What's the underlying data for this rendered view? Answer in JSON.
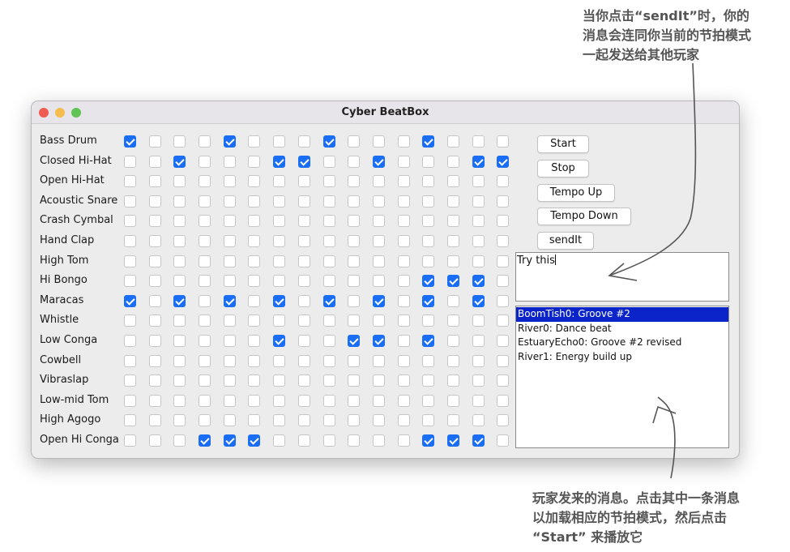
{
  "annotations": {
    "top": "当你点击“sendIt”时，你的\n消息会连同你当前的节拍模式\n一起发送给其他玩家",
    "bottom": "玩家发来的消息。点击其中一条消息\n以加载相应的节拍模式，然后点击\n“Start” 来播放它"
  },
  "window": {
    "title": "Cyber BeatBox"
  },
  "instruments": [
    "Bass Drum",
    "Closed Hi-Hat",
    "Open Hi-Hat",
    "Acoustic Snare",
    "Crash Cymbal",
    "Hand Clap",
    "High Tom",
    "Hi Bongo",
    "Maracas",
    "Whistle",
    "Low Conga",
    "Cowbell",
    "Vibraslap",
    "Low-mid Tom",
    "High Agogo",
    "Open Hi Conga"
  ],
  "grid": [
    [
      1,
      0,
      0,
      0,
      1,
      0,
      0,
      0,
      1,
      0,
      0,
      0,
      1,
      0,
      0,
      0
    ],
    [
      0,
      0,
      1,
      0,
      0,
      0,
      1,
      1,
      0,
      0,
      1,
      0,
      0,
      0,
      1,
      1
    ],
    [
      0,
      0,
      0,
      0,
      0,
      0,
      0,
      0,
      0,
      0,
      0,
      0,
      0,
      0,
      0,
      0
    ],
    [
      0,
      0,
      0,
      0,
      0,
      0,
      0,
      0,
      0,
      0,
      0,
      0,
      0,
      0,
      0,
      0
    ],
    [
      0,
      0,
      0,
      0,
      0,
      0,
      0,
      0,
      0,
      0,
      0,
      0,
      0,
      0,
      0,
      0
    ],
    [
      0,
      0,
      0,
      0,
      0,
      0,
      0,
      0,
      0,
      0,
      0,
      0,
      0,
      0,
      0,
      0
    ],
    [
      0,
      0,
      0,
      0,
      0,
      0,
      0,
      0,
      0,
      0,
      0,
      0,
      0,
      0,
      0,
      0
    ],
    [
      0,
      0,
      0,
      0,
      0,
      0,
      0,
      0,
      0,
      0,
      0,
      0,
      1,
      1,
      1,
      0
    ],
    [
      1,
      0,
      1,
      0,
      1,
      0,
      1,
      0,
      1,
      0,
      1,
      0,
      1,
      0,
      1,
      0
    ],
    [
      0,
      0,
      0,
      0,
      0,
      0,
      0,
      0,
      0,
      0,
      0,
      0,
      0,
      0,
      0,
      0
    ],
    [
      0,
      0,
      0,
      0,
      0,
      0,
      1,
      0,
      0,
      1,
      1,
      0,
      1,
      0,
      0,
      0
    ],
    [
      0,
      0,
      0,
      0,
      0,
      0,
      0,
      0,
      0,
      0,
      0,
      0,
      0,
      0,
      0,
      0
    ],
    [
      0,
      0,
      0,
      0,
      0,
      0,
      0,
      0,
      0,
      0,
      0,
      0,
      0,
      0,
      0,
      0
    ],
    [
      0,
      0,
      0,
      0,
      0,
      0,
      0,
      0,
      0,
      0,
      0,
      0,
      0,
      0,
      0,
      0
    ],
    [
      0,
      0,
      0,
      0,
      0,
      0,
      0,
      0,
      0,
      0,
      0,
      0,
      0,
      0,
      0,
      0
    ],
    [
      0,
      0,
      0,
      1,
      1,
      1,
      0,
      0,
      0,
      0,
      0,
      0,
      1,
      1,
      1,
      0
    ]
  ],
  "buttons": {
    "start": "Start",
    "stop": "Stop",
    "tempo_up": "Tempo Up",
    "tempo_down": "Tempo Down",
    "send": "sendIt"
  },
  "message_input": {
    "value": "Try this"
  },
  "incoming_messages": [
    "BoomTish0: Groove #2",
    "River0: Dance beat",
    "EstuaryEcho0: Groove #2 revised",
    "River1: Energy build up"
  ],
  "selected_message_index": 0,
  "colors": {
    "checkbox_checked": "#1a6ef5",
    "selection": "#0b24c9",
    "close": "#ee5b51",
    "minimize": "#f5bd4f",
    "maximize": "#5fc454"
  }
}
